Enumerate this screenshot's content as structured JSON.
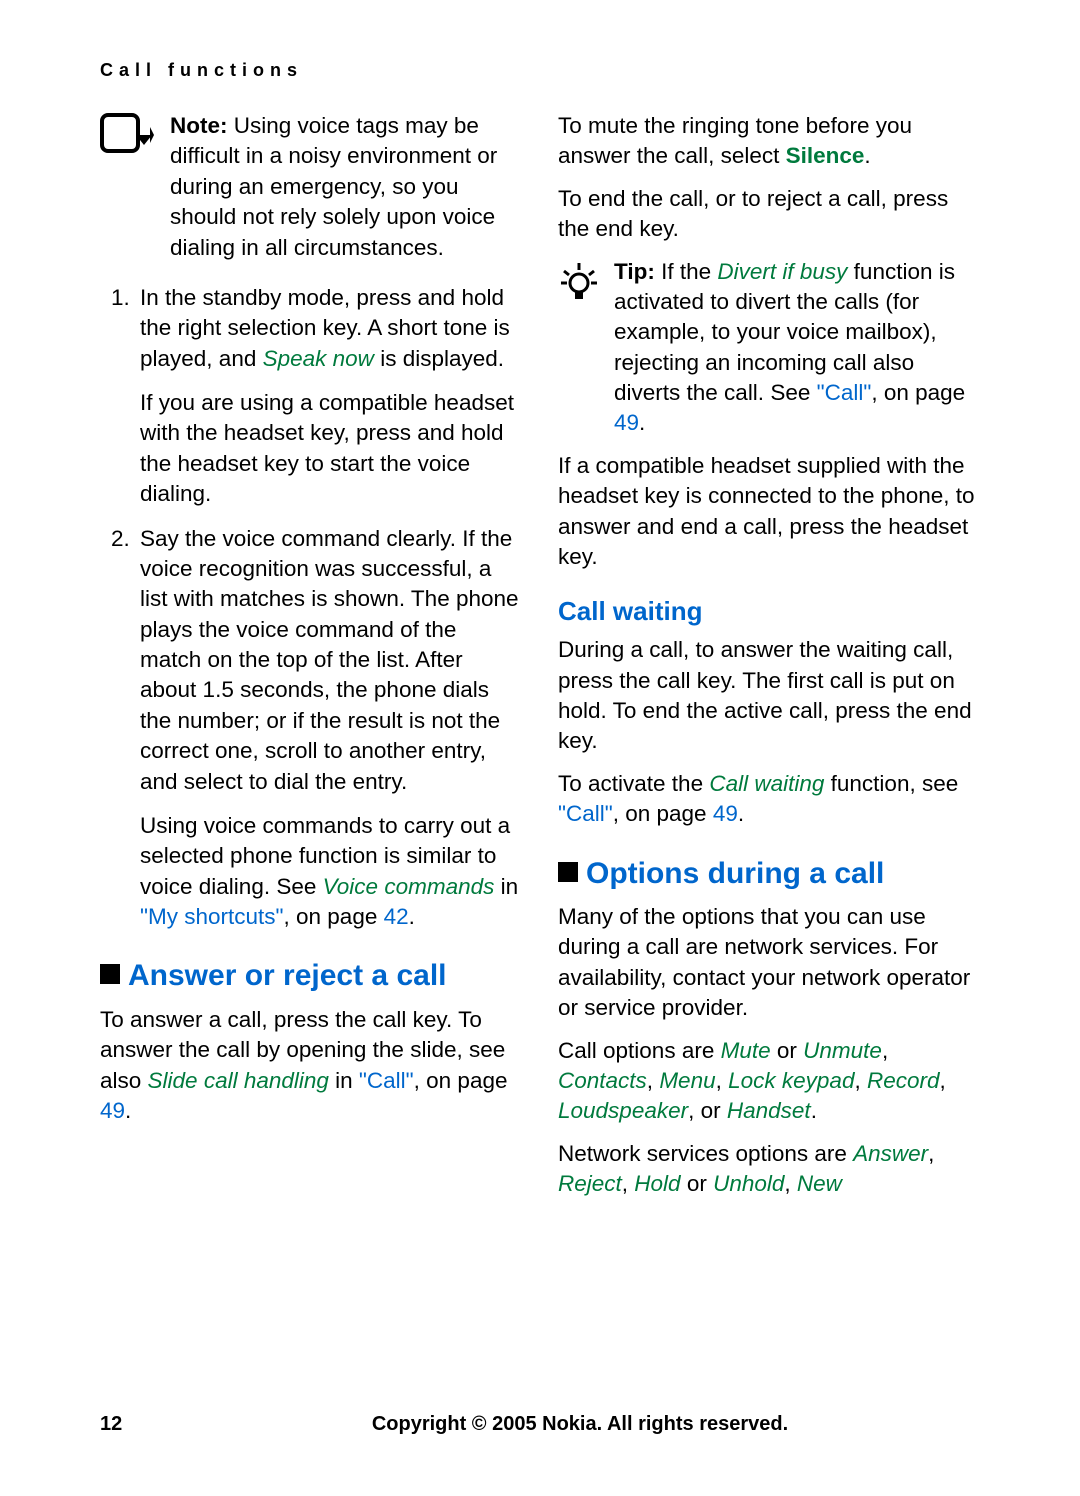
{
  "header": "Call functions",
  "left": {
    "note_label": "Note:",
    "note_text": " Using voice tags may be difficult in a noisy environment or during an emergency, so you should not rely solely upon voice dialing in all circumstances.",
    "li1_a": "In the standby mode, press and hold the right selection key. A short tone is played, and ",
    "li1_speak": "Speak now",
    "li1_b": " is displayed.",
    "li1_sub": "If you are using a compatible headset with the headset key, press and hold the headset key to start the voice dialing.",
    "li2_a": "Say the voice command clearly. If the voice recognition was successful, a list with matches is shown. The phone plays the voice command of the match on the top of the list. After about 1.5 seconds, the phone dials the number; or if the result is not the correct one, scroll to another entry, and select to dial the entry.",
    "li2_sub_a": "Using voice commands to carry out a selected phone function is similar to voice dialing. See ",
    "li2_sub_voice": "Voice commands",
    "li2_sub_in": " in ",
    "li2_sub_link": "\"My shortcuts\"",
    "li2_sub_on": ", on page ",
    "li2_sub_pg": "42",
    "li2_sub_dot": ".",
    "h1": "Answer or reject a call",
    "p_ans_a": "To answer a call, press the call key. To answer the call by opening the slide, see also ",
    "p_ans_slide": "Slide call handling",
    "p_ans_in": " in ",
    "p_ans_link": "\"Call\"",
    "p_ans_on": ", on page ",
    "p_ans_pg": "49",
    "p_ans_dot": "."
  },
  "right": {
    "mute_a": "To mute the ringing tone before you answer the call, select ",
    "mute_silence": "Silence",
    "mute_dot": ".",
    "end_text": "To end the call, or to reject a call, press the end key.",
    "tip_label": "Tip:",
    "tip_a": " If the ",
    "tip_divert": "Divert if busy",
    "tip_b": " function is activated to divert the calls (for example, to your voice mailbox), rejecting an incoming call also diverts the call. See ",
    "tip_link": "\"Call\"",
    "tip_on": ", on page ",
    "tip_pg": "49",
    "tip_dot": ".",
    "headset": "If a compatible headset supplied with the headset key is connected to the phone, to answer and end a call, press the headset key.",
    "h2": "Call waiting",
    "cw_p1": "During a call, to answer the waiting call, press the call key. The first call is put on hold. To end the active call, press the end key.",
    "cw_p2_a": "To activate the ",
    "cw_p2_cw": "Call waiting",
    "cw_p2_b": " function, see ",
    "cw_p2_link": "\"Call\"",
    "cw_p2_on": ", on page ",
    "cw_p2_pg": "49",
    "cw_p2_dot": ".",
    "h1": "Options during a call",
    "opt_p1": "Many of the options that you can use during a call are network services. For availability, contact your network operator or service provider.",
    "opt_p2_a": "Call options are ",
    "opt_mute": "Mute",
    "opt_or1": " or ",
    "opt_unmute": "Unmute",
    "opt_c1": ", ",
    "opt_contacts": "Contacts",
    "opt_c2": ", ",
    "opt_menu": "Menu",
    "opt_c3": ", ",
    "opt_lock": "Lock keypad",
    "opt_c4": ", ",
    "opt_record": "Record",
    "opt_c5": ", ",
    "opt_loud": "Loudspeaker",
    "opt_or2": ", or ",
    "opt_handset": "Handset",
    "opt_dot": ".",
    "net_a": "Network services options are ",
    "net_answer": "Answer",
    "net_c1": ", ",
    "net_reject": "Reject",
    "net_c2": ", ",
    "net_hold": "Hold",
    "net_or": " or ",
    "net_unhold": "Unhold",
    "net_c3": ", ",
    "net_new": "New"
  },
  "footer": {
    "page": "12",
    "copyright": "Copyright © 2005 Nokia. All rights reserved."
  }
}
